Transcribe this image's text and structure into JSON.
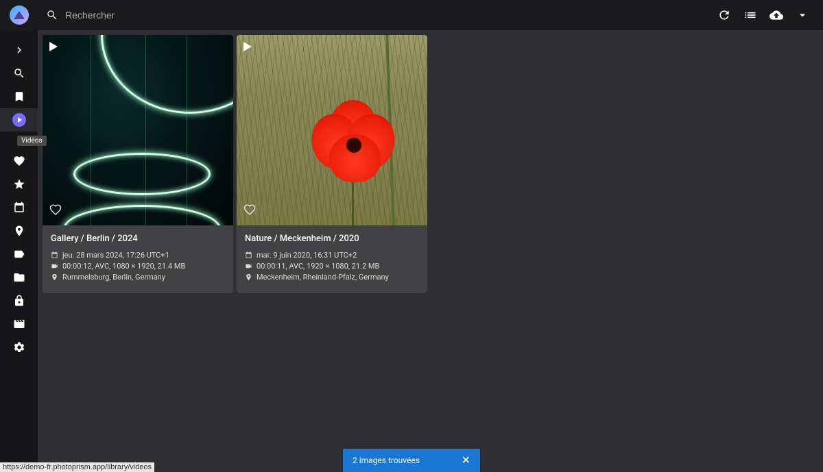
{
  "header": {
    "search_placeholder": "Rechercher"
  },
  "sidebar": {
    "tooltip": "Vidéos"
  },
  "cards": [
    {
      "title": "Gallery / Berlin / 2024",
      "date": "jeu. 28 mars 2024, 17:26 UTC+1",
      "video": "00:00:12, AVC, 1080 × 1920, 21.4 MB",
      "location": "Rummelsburg, Berlin, Germany"
    },
    {
      "title": "Nature / Meckenheim / 2020",
      "date": "mar. 9 juin 2020, 16:31 UTC+2",
      "video": "00:00:11, AVC, 1920 × 1080, 21.2 MB",
      "location": "Meckenheim, Rheinland-Pfalz, Germany"
    }
  ],
  "snackbar": {
    "message": "2 images trouvées"
  },
  "status_url": "https://demo-fr.photoprism.app/library/videos"
}
